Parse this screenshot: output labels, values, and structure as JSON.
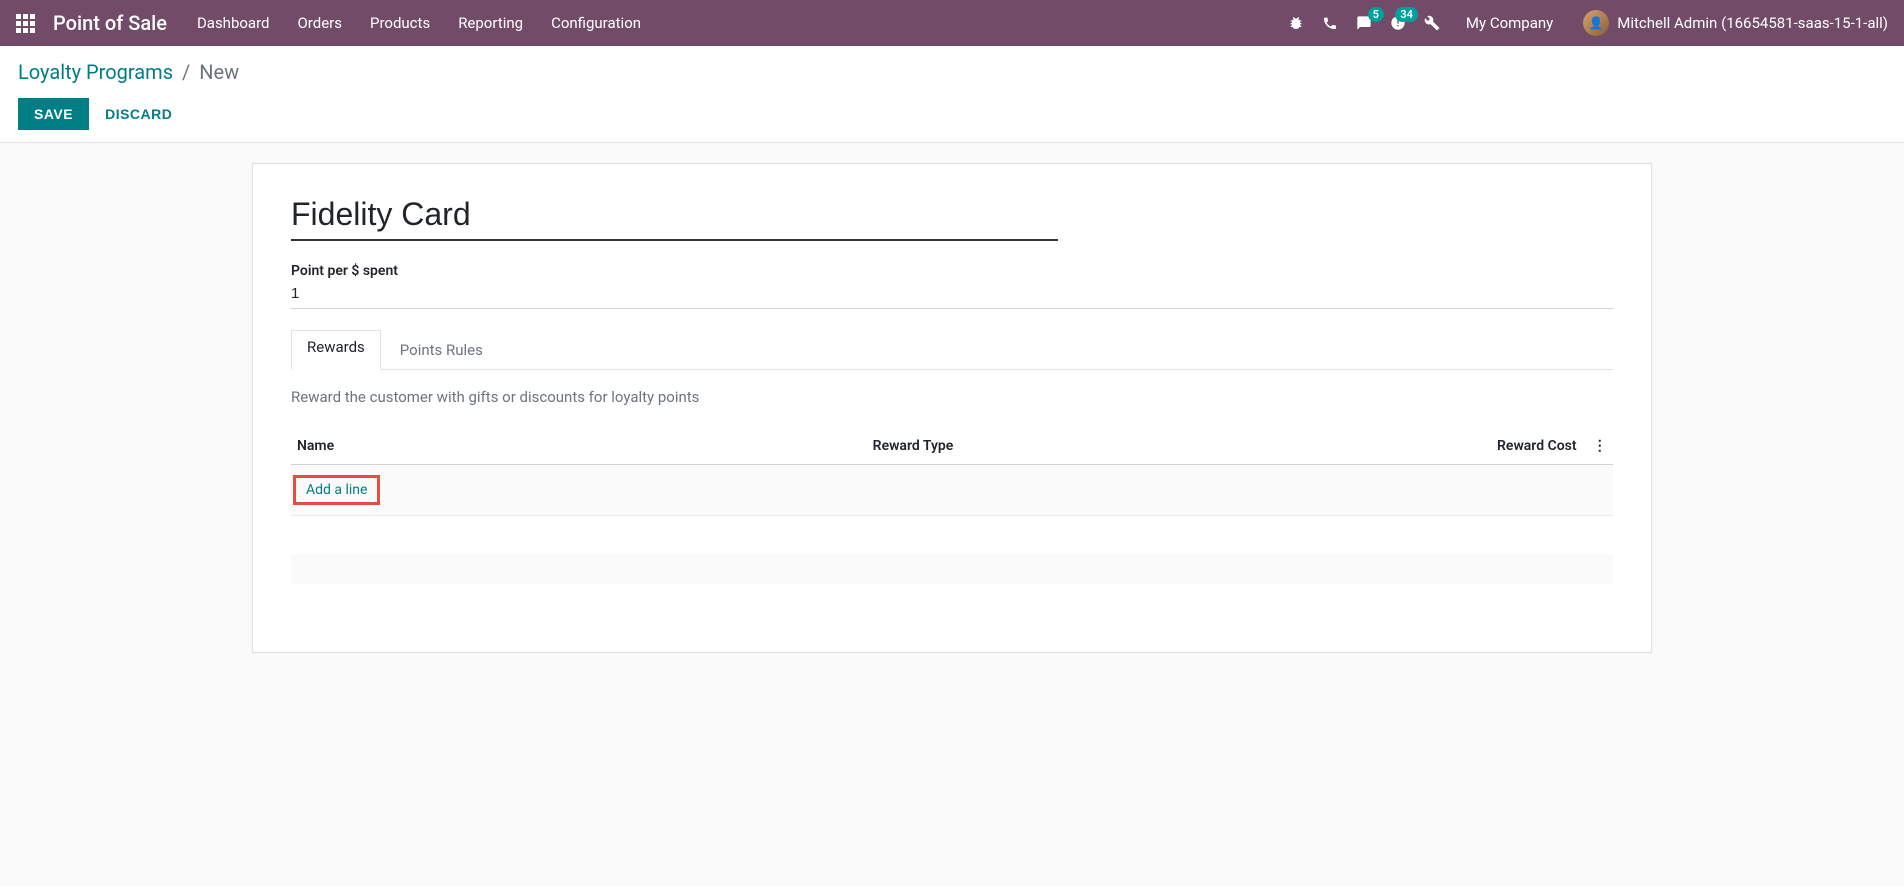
{
  "nav": {
    "brand": "Point of Sale",
    "links": [
      "Dashboard",
      "Orders",
      "Products",
      "Reporting",
      "Configuration"
    ],
    "company": "My Company",
    "user": "Mitchell Admin (16654581-saas-15-1-all)",
    "badge_msg": "5",
    "badge_act": "34"
  },
  "breadcrumb": {
    "parent": "Loyalty Programs",
    "current": "New"
  },
  "actions": {
    "save": "SAVE",
    "discard": "DISCARD"
  },
  "form": {
    "title": "Fidelity Card",
    "point_label": "Point per $ spent",
    "point_value": "1"
  },
  "tabs": {
    "rewards": "Rewards",
    "points_rules": "Points Rules"
  },
  "rewards_tab": {
    "description": "Reward the customer with gifts or discounts for loyalty points",
    "columns": {
      "name": "Name",
      "type": "Reward Type",
      "cost": "Reward Cost"
    },
    "add_line": "Add a line"
  }
}
